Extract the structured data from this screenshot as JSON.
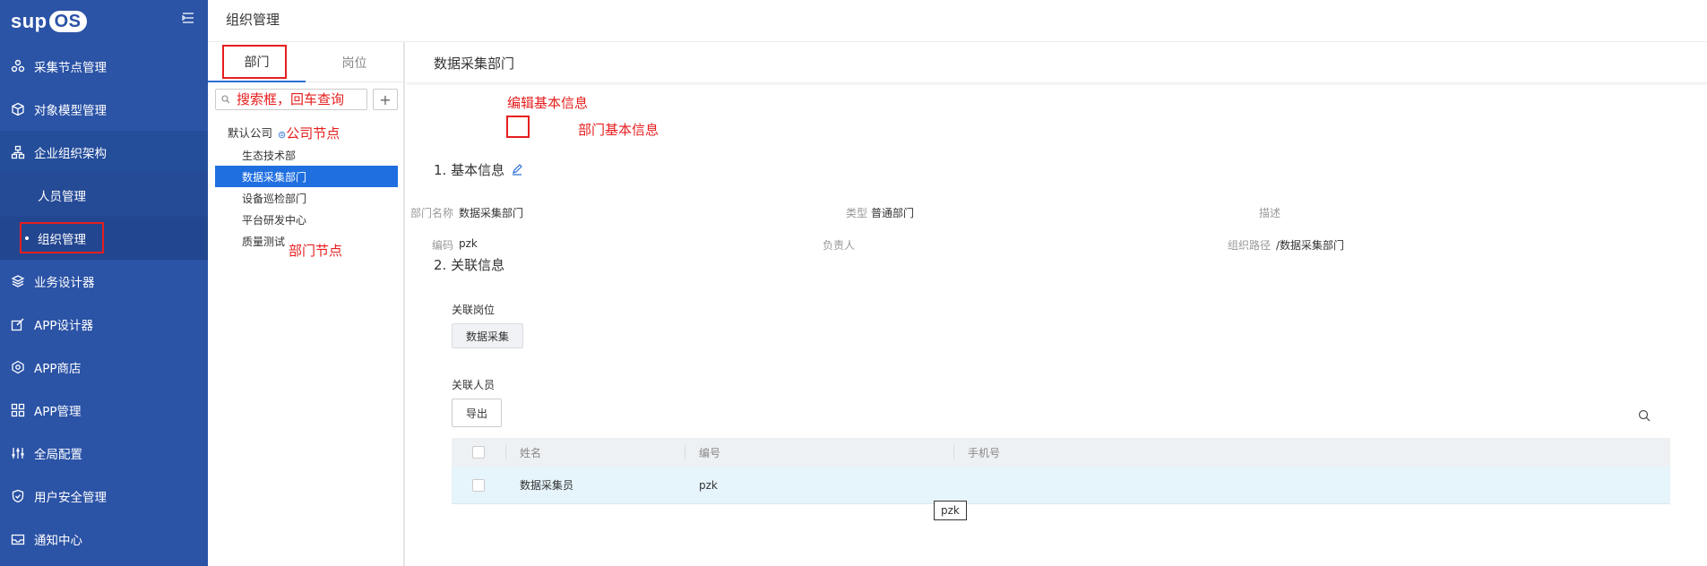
{
  "app": {
    "logo_text": "sup",
    "logo_os": "OS"
  },
  "sidebar": {
    "items": [
      {
        "label": "采集节点管理",
        "icon": "nodes-icon"
      },
      {
        "label": "对象模型管理",
        "icon": "cube-icon"
      },
      {
        "label": "企业组织架构",
        "icon": "org-chart-icon"
      },
      {
        "label": "人员管理"
      },
      {
        "label": "组织管理"
      },
      {
        "label": "业务设计器",
        "icon": "layers-icon"
      },
      {
        "label": "APP设计器",
        "icon": "edit-app-icon"
      },
      {
        "label": "APP商店",
        "icon": "store-icon"
      },
      {
        "label": "APP管理",
        "icon": "grid-icon"
      },
      {
        "label": "全局配置",
        "icon": "sliders-icon"
      },
      {
        "label": "用户安全管理",
        "icon": "shield-icon"
      },
      {
        "label": "通知中心",
        "icon": "inbox-icon"
      }
    ]
  },
  "header": {
    "title": "组织管理"
  },
  "left_panel": {
    "tabs": [
      "部门",
      "岗位"
    ],
    "search_placeholder": "",
    "add_label": "+",
    "root": "默认公司",
    "nodes": [
      "生态技术部",
      "数据采集部门",
      "设备巡检部门",
      "平台研发中心",
      "质量测试"
    ]
  },
  "detail": {
    "title": "数据采集部门",
    "basic_section": "1. 基本信息",
    "fields": {
      "name_label": "部门名称",
      "name_value": "数据采集部门",
      "type_label": "类型",
      "type_value": "普通部门",
      "desc_label": "描述",
      "desc_value": "",
      "code_label": "编码",
      "code_value": "pzk",
      "owner_label": "负责人",
      "owner_value": "",
      "path_label": "组织路径",
      "path_value": "/数据采集部门"
    },
    "related_section": "2. 关联信息",
    "related_post_label": "关联岗位",
    "related_post_chip": "数据采集",
    "related_people_label": "关联人员",
    "export_label": "导出",
    "table": {
      "headers": [
        "姓名",
        "编号",
        "手机号"
      ],
      "rows": [
        {
          "name": "数据采集员",
          "code": "pzk",
          "phone": ""
        }
      ]
    },
    "tooltip": "pzk"
  },
  "annotations": {
    "search_note": "搜索框，回车查询",
    "company_node_note": "公司节点",
    "dept_node_note": "部门节点",
    "edit_note": "编辑基本信息",
    "basic_note": "部门基本信息",
    "color": "#e61e1e"
  }
}
